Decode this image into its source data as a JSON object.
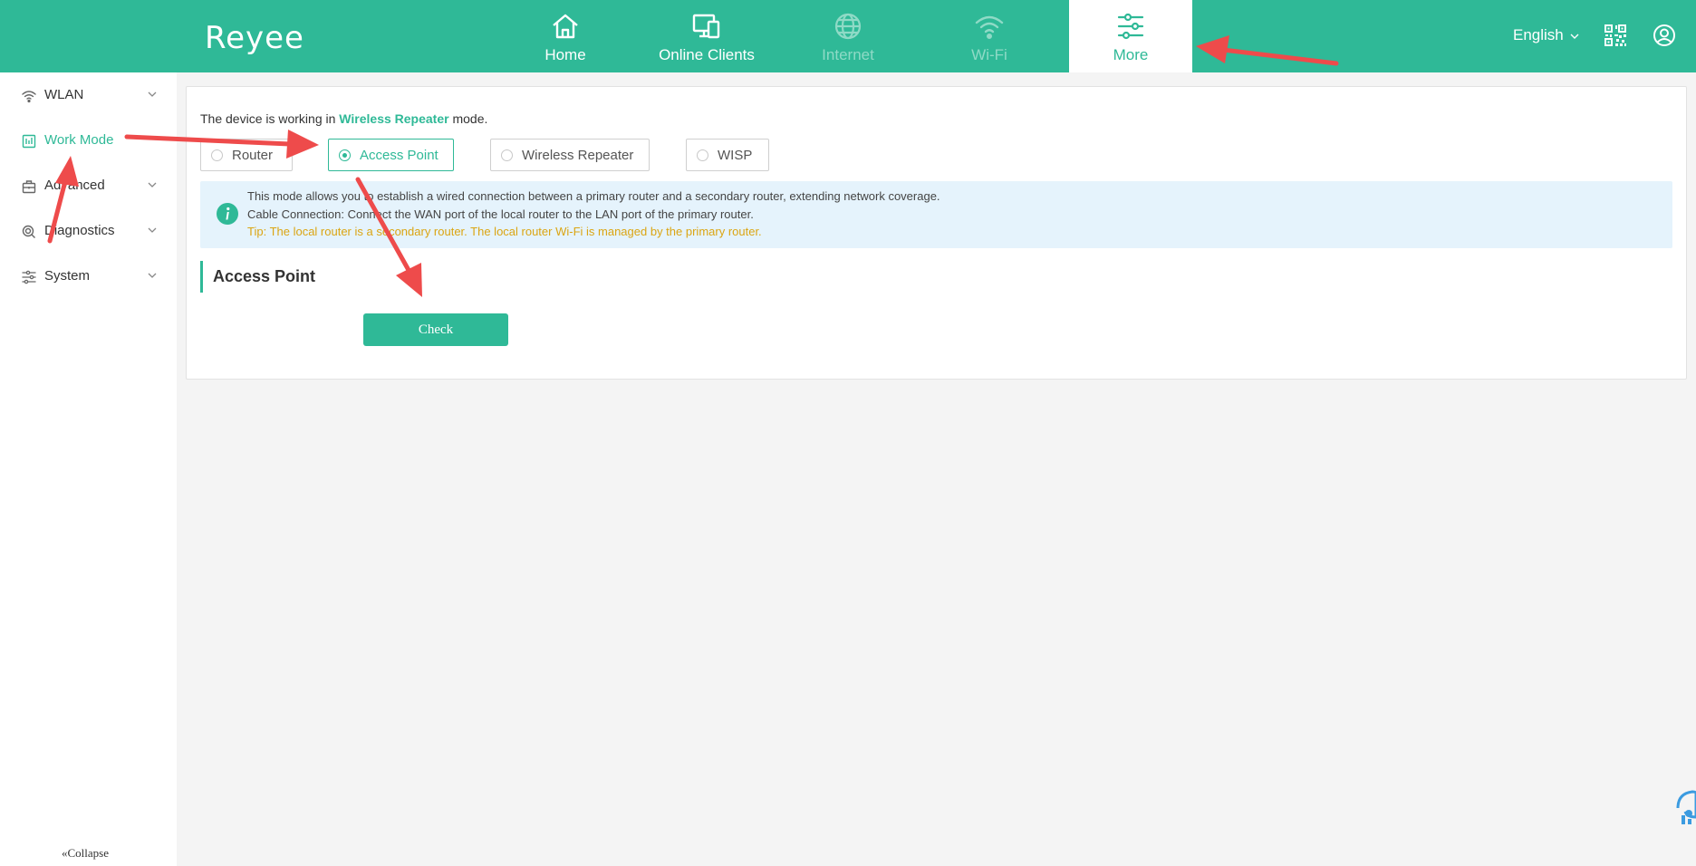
{
  "header": {
    "logo": "Reyee",
    "nav": [
      {
        "label": "Home",
        "icon": "home-icon",
        "state": "normal"
      },
      {
        "label": "Online Clients",
        "icon": "devices-icon",
        "state": "normal"
      },
      {
        "label": "Internet",
        "icon": "globe-icon",
        "state": "disabled"
      },
      {
        "label": "Wi-Fi",
        "icon": "wifi-icon",
        "state": "disabled"
      },
      {
        "label": "More",
        "icon": "sliders-icon",
        "state": "active"
      }
    ],
    "language": "English",
    "right_icons": [
      "qr-code-icon",
      "user-icon"
    ]
  },
  "sidebar": {
    "items": [
      {
        "label": "WLAN",
        "icon": "wifi-icon",
        "expandable": true
      },
      {
        "label": "Work Mode",
        "icon": "work-mode-icon",
        "active": true
      },
      {
        "label": "Advanced",
        "icon": "toolbox-icon",
        "expandable": true
      },
      {
        "label": "Diagnostics",
        "icon": "diagnostics-icon",
        "expandable": true
      },
      {
        "label": "System",
        "icon": "settings-sliders-icon",
        "expandable": true
      }
    ],
    "collapse_label": "Collapse"
  },
  "main": {
    "status_prefix": "The device is working in ",
    "status_mode": "Wireless Repeater",
    "status_suffix": " mode.",
    "modes": [
      {
        "label": "Router",
        "checked": false
      },
      {
        "label": "Access Point",
        "checked": true
      },
      {
        "label": "Wireless Repeater",
        "checked": false
      },
      {
        "label": "WISP",
        "checked": false
      }
    ],
    "info": {
      "line1": "This mode allows you to establish a wired connection between a primary router and a secondary router, extending network coverage.",
      "line2": "Cable Connection: Connect the WAN port of the local router to the LAN port of the primary router.",
      "tip": "Tip: The local router is a secondary router. The local router Wi-Fi is managed by the primary router."
    },
    "section_title": "Access Point",
    "check_button": "Check"
  },
  "colors": {
    "brand": "#2fb997",
    "tip": "#dba512",
    "info_bg": "#e5f3fc",
    "annotation": "#ee4b4b"
  }
}
